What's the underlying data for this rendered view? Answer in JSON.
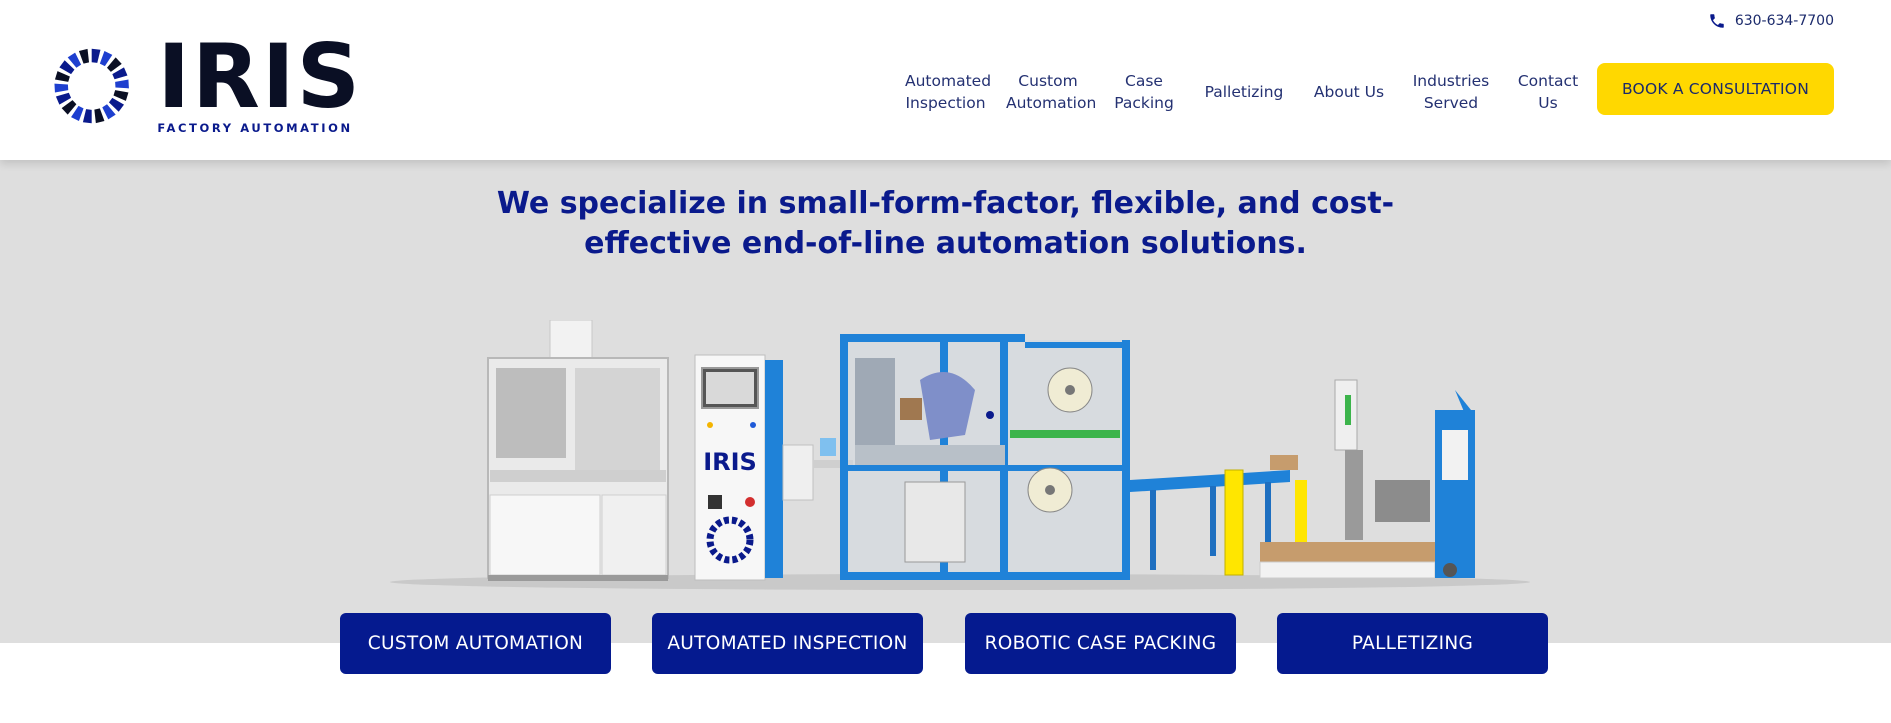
{
  "brand": {
    "name": "IRIS",
    "tagline": "FACTORY AUTOMATION",
    "logo_icon": "iris-ring-logo",
    "colors": {
      "navy": "#051a8f",
      "yellow": "#ffd800",
      "blue": "#1f82d8"
    }
  },
  "header": {
    "phone": "630-634-7700",
    "phone_icon": "phone-icon",
    "nav": [
      {
        "label": "Automated\nInspection"
      },
      {
        "label": "Custom\nAutomation"
      },
      {
        "label": "Case\nPacking"
      },
      {
        "label": "Palletizing"
      },
      {
        "label": "About Us"
      },
      {
        "label": "Industries\nServed"
      },
      {
        "label": "Contact\nUs"
      }
    ],
    "cta": "BOOK A CONSULTATION"
  },
  "hero": {
    "headline_line1": "We specialize in small-form-factor, flexible, and cost-",
    "headline_line2": "effective end-of-line automation solutions.",
    "machine_label": "IRIS",
    "buttons": [
      {
        "label": "CUSTOM AUTOMATION"
      },
      {
        "label": "AUTOMATED INSPECTION"
      },
      {
        "label": "ROBOTIC CASE PACKING"
      },
      {
        "label": "PALLETIZING"
      }
    ]
  }
}
